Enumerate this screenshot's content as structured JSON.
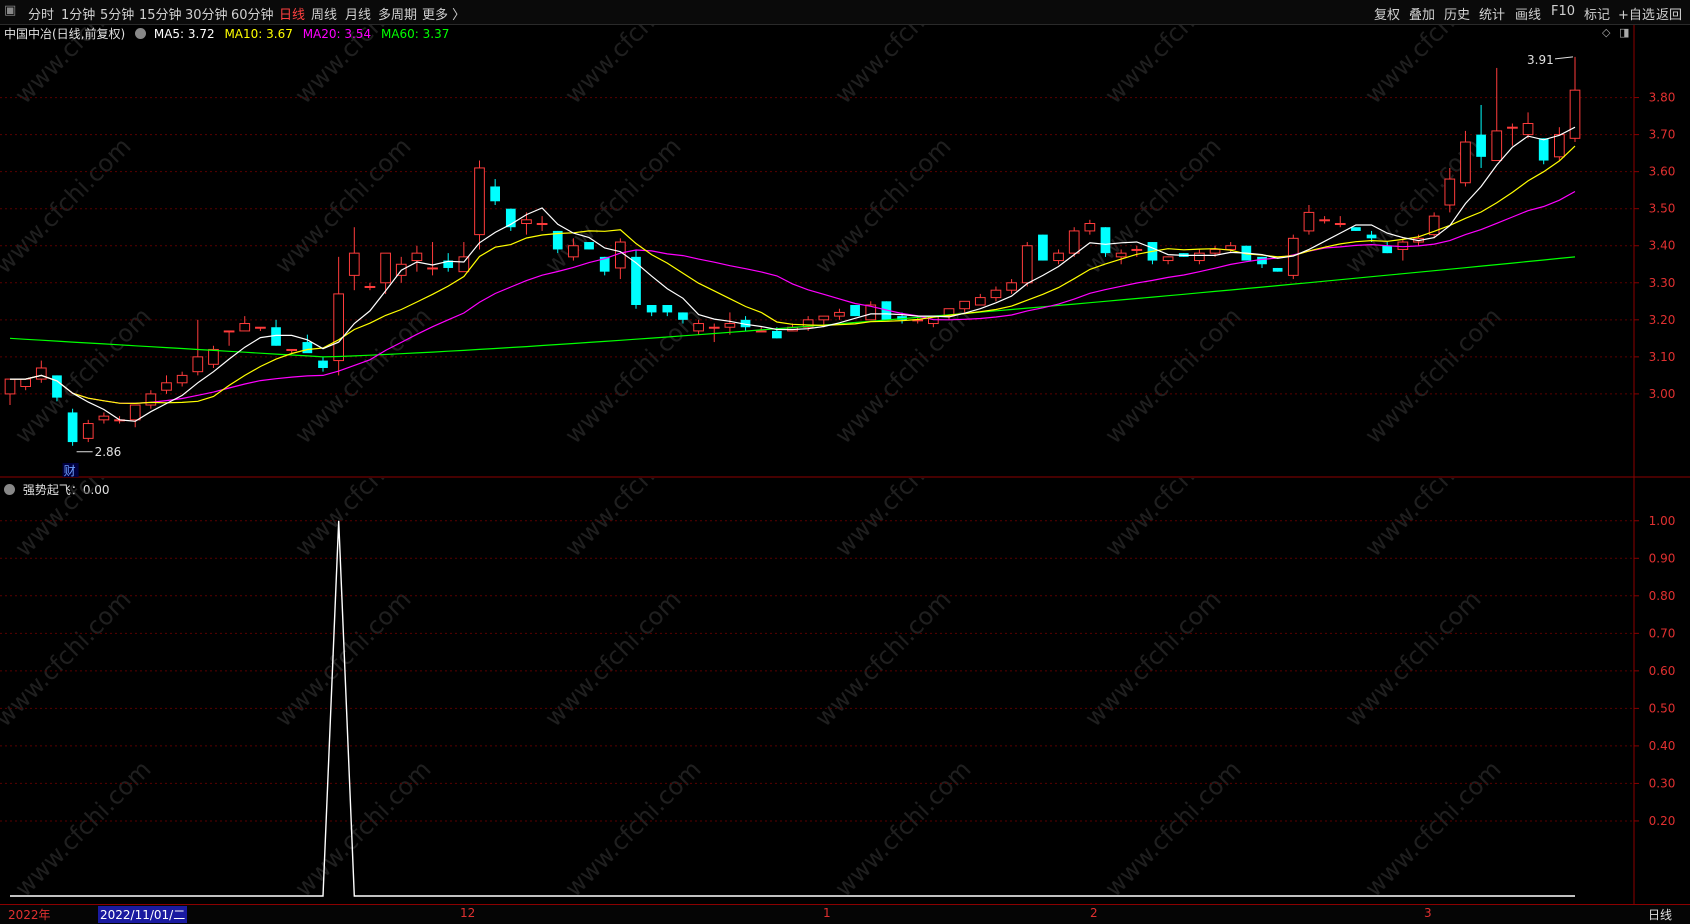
{
  "toolbar": {
    "left_items": [
      "分时",
      "1分钟",
      "5分钟",
      "15分钟",
      "30分钟",
      "60分钟",
      "日线",
      "周线",
      "月线",
      "多周期",
      "更多 〉"
    ],
    "active": "日线",
    "right_items": [
      "复权",
      "叠加",
      "历史",
      "统计",
      "画线",
      "F10",
      "标记",
      "+自选",
      "返回"
    ]
  },
  "price_panel": {
    "title": "中国中冶(日线,前复权)",
    "ma": [
      {
        "label": "MA5: 3.72",
        "color": "#ffffff"
      },
      {
        "label": "MA10: 3.67",
        "color": "#ffff00"
      },
      {
        "label": "MA20: 3.54",
        "color": "#ff00ff"
      },
      {
        "label": "MA60: 3.37",
        "color": "#00ff00"
      }
    ],
    "y_ticks": [
      "3.80",
      "3.70",
      "3.60",
      "3.50",
      "3.40",
      "3.30",
      "3.20",
      "3.10",
      "3.00"
    ],
    "high_label": "3.91",
    "low_label": "2.86",
    "fin_badge": "财"
  },
  "indicator_panel": {
    "title": "强势起飞：0.00",
    "y_ticks": [
      "1.00",
      "0.90",
      "0.80",
      "0.70",
      "0.60",
      "0.50",
      "0.40",
      "0.30",
      "0.20"
    ]
  },
  "bottom_bar": {
    "year_label": "2022年",
    "cursor_date": "2022/11/01/二",
    "month_labels": [
      "12",
      "1",
      "2",
      "3"
    ],
    "period_label": "日线"
  },
  "watermark": "www.cfchi.com",
  "colors": {
    "up": "#ff3c3c",
    "down": "#00ffff",
    "grid": "#5a0000",
    "axis": "#8b0000"
  },
  "chart_data": {
    "type": "candlestick",
    "ylim": [
      2.8,
      3.95
    ],
    "candles": [
      [
        3.0,
        3.04,
        2.97,
        3.04
      ],
      [
        3.02,
        3.04,
        3.01,
        3.04
      ],
      [
        3.04,
        3.09,
        3.03,
        3.07
      ],
      [
        3.05,
        3.05,
        2.98,
        2.99
      ],
      [
        2.95,
        2.96,
        2.86,
        2.87
      ],
      [
        2.88,
        2.93,
        2.87,
        2.92
      ],
      [
        2.93,
        2.95,
        2.92,
        2.94
      ],
      [
        2.93,
        2.94,
        2.92,
        2.93
      ],
      [
        2.93,
        2.97,
        2.91,
        2.97
      ],
      [
        2.97,
        3.01,
        2.96,
        3.0
      ],
      [
        3.01,
        3.05,
        3.0,
        3.03
      ],
      [
        3.03,
        3.06,
        3.02,
        3.05
      ],
      [
        3.06,
        3.2,
        3.05,
        3.1
      ],
      [
        3.08,
        3.13,
        3.07,
        3.12
      ],
      [
        3.17,
        3.17,
        3.13,
        3.17
      ],
      [
        3.17,
        3.21,
        3.17,
        3.19
      ],
      [
        3.18,
        3.18,
        3.17,
        3.18
      ],
      [
        3.18,
        3.2,
        3.13,
        3.13
      ],
      [
        3.12,
        3.12,
        3.11,
        3.12
      ],
      [
        3.14,
        3.16,
        3.13,
        3.11
      ],
      [
        3.09,
        3.1,
        3.06,
        3.07
      ],
      [
        3.09,
        3.37,
        3.05,
        3.27
      ],
      [
        3.32,
        3.45,
        3.28,
        3.38
      ],
      [
        3.29,
        3.3,
        3.28,
        3.29
      ],
      [
        3.3,
        3.38,
        3.27,
        3.38
      ],
      [
        3.32,
        3.37,
        3.3,
        3.35
      ],
      [
        3.36,
        3.4,
        3.33,
        3.38
      ],
      [
        3.34,
        3.41,
        3.32,
        3.34
      ],
      [
        3.36,
        3.38,
        3.33,
        3.34
      ],
      [
        3.33,
        3.41,
        3.33,
        3.37
      ],
      [
        3.43,
        3.63,
        3.39,
        3.61
      ],
      [
        3.56,
        3.58,
        3.51,
        3.52
      ],
      [
        3.5,
        3.5,
        3.44,
        3.45
      ],
      [
        3.46,
        3.49,
        3.43,
        3.47
      ],
      [
        3.46,
        3.48,
        3.44,
        3.46
      ],
      [
        3.44,
        3.44,
        3.38,
        3.39
      ],
      [
        3.37,
        3.42,
        3.36,
        3.4
      ],
      [
        3.41,
        3.41,
        3.39,
        3.39
      ],
      [
        3.37,
        3.37,
        3.32,
        3.33
      ],
      [
        3.34,
        3.42,
        3.31,
        3.41
      ],
      [
        3.37,
        3.39,
        3.23,
        3.24
      ],
      [
        3.24,
        3.24,
        3.21,
        3.22
      ],
      [
        3.24,
        3.24,
        3.21,
        3.22
      ],
      [
        3.22,
        3.22,
        3.19,
        3.2
      ],
      [
        3.17,
        3.2,
        3.16,
        3.19
      ],
      [
        3.18,
        3.19,
        3.14,
        3.18
      ],
      [
        3.18,
        3.22,
        3.16,
        3.19
      ],
      [
        3.2,
        3.21,
        3.17,
        3.18
      ],
      [
        3.17,
        3.18,
        3.17,
        3.17
      ],
      [
        3.17,
        3.18,
        3.15,
        3.15
      ],
      [
        3.17,
        3.19,
        3.17,
        3.18
      ],
      [
        3.18,
        3.21,
        3.17,
        3.2
      ],
      [
        3.2,
        3.21,
        3.18,
        3.21
      ],
      [
        3.21,
        3.23,
        3.2,
        3.22
      ],
      [
        3.24,
        3.24,
        3.21,
        3.21
      ],
      [
        3.2,
        3.25,
        3.2,
        3.24
      ],
      [
        3.25,
        3.25,
        3.2,
        3.2
      ],
      [
        3.21,
        3.22,
        3.19,
        3.2
      ],
      [
        3.2,
        3.21,
        3.19,
        3.2
      ],
      [
        3.19,
        3.21,
        3.18,
        3.21
      ],
      [
        3.21,
        3.23,
        3.2,
        3.23
      ],
      [
        3.23,
        3.25,
        3.22,
        3.25
      ],
      [
        3.24,
        3.27,
        3.24,
        3.26
      ],
      [
        3.26,
        3.29,
        3.25,
        3.28
      ],
      [
        3.28,
        3.31,
        3.27,
        3.3
      ],
      [
        3.3,
        3.41,
        3.29,
        3.4
      ],
      [
        3.43,
        3.43,
        3.36,
        3.36
      ],
      [
        3.36,
        3.39,
        3.35,
        3.38
      ],
      [
        3.38,
        3.45,
        3.37,
        3.44
      ],
      [
        3.44,
        3.47,
        3.43,
        3.46
      ],
      [
        3.45,
        3.45,
        3.37,
        3.38
      ],
      [
        3.37,
        3.39,
        3.35,
        3.38
      ],
      [
        3.39,
        3.4,
        3.37,
        3.39
      ],
      [
        3.41,
        3.41,
        3.35,
        3.36
      ],
      [
        3.36,
        3.37,
        3.35,
        3.37
      ],
      [
        3.38,
        3.38,
        3.37,
        3.37
      ],
      [
        3.36,
        3.39,
        3.35,
        3.38
      ],
      [
        3.38,
        3.4,
        3.37,
        3.39
      ],
      [
        3.39,
        3.41,
        3.38,
        3.4
      ],
      [
        3.4,
        3.4,
        3.36,
        3.36
      ],
      [
        3.37,
        3.37,
        3.34,
        3.35
      ],
      [
        3.34,
        3.34,
        3.33,
        3.33
      ],
      [
        3.32,
        3.43,
        3.31,
        3.42
      ],
      [
        3.44,
        3.51,
        3.43,
        3.49
      ],
      [
        3.47,
        3.48,
        3.46,
        3.47
      ],
      [
        3.46,
        3.48,
        3.45,
        3.46
      ],
      [
        3.45,
        3.45,
        3.44,
        3.44
      ],
      [
        3.43,
        3.44,
        3.41,
        3.42
      ],
      [
        3.4,
        3.41,
        3.38,
        3.38
      ],
      [
        3.39,
        3.42,
        3.36,
        3.41
      ],
      [
        3.41,
        3.43,
        3.4,
        3.42
      ],
      [
        3.43,
        3.49,
        3.42,
        3.48
      ],
      [
        3.51,
        3.61,
        3.49,
        3.58
      ],
      [
        3.57,
        3.71,
        3.56,
        3.68
      ],
      [
        3.7,
        3.78,
        3.61,
        3.64
      ],
      [
        3.63,
        3.88,
        3.63,
        3.71
      ],
      [
        3.72,
        3.73,
        3.67,
        3.72
      ],
      [
        3.7,
        3.76,
        3.69,
        3.73
      ],
      [
        3.69,
        3.69,
        3.62,
        3.63
      ],
      [
        3.64,
        3.72,
        3.63,
        3.7
      ],
      [
        3.69,
        3.91,
        3.68,
        3.82
      ]
    ],
    "ma5_last": 3.72,
    "ma10_last": 3.67,
    "ma20_last": 3.54,
    "ma60_last": 3.37,
    "indicator": {
      "name": "强势起飞",
      "ylim": [
        0,
        1.05
      ],
      "spike_index": 21,
      "spike_value": 1.0
    }
  }
}
